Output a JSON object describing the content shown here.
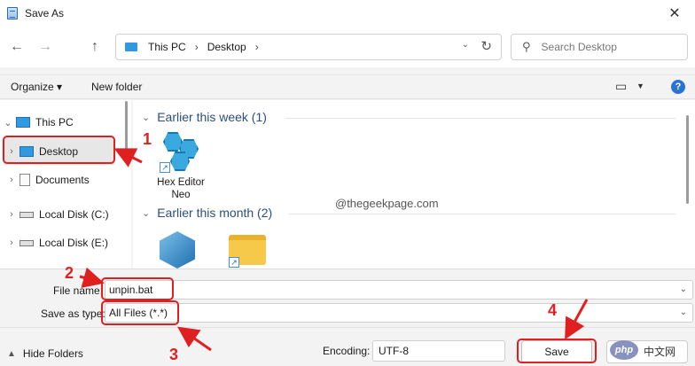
{
  "window": {
    "title": "Save As",
    "close_glyph": "✕"
  },
  "nav": {
    "back_glyph": "←",
    "forward_glyph": "→",
    "up_glyph": "↑"
  },
  "address": {
    "crumbs": [
      "This PC",
      "Desktop"
    ],
    "separator": "›",
    "dropdown_glyph": "⌄",
    "refresh_glyph": "↻"
  },
  "search": {
    "placeholder": "Search Desktop",
    "icon": "search-icon"
  },
  "commandbar": {
    "organize": "Organize ▾",
    "new_folder": "New folder",
    "help": "?"
  },
  "sidebar": {
    "items": [
      {
        "label": "This PC",
        "icon": "computer-icon",
        "chevron": "⌄"
      },
      {
        "label": "Desktop",
        "icon": "desktop-icon",
        "chevron": "›",
        "selected": true
      },
      {
        "label": "Documents",
        "icon": "documents-icon",
        "chevron": "›"
      },
      {
        "label": "Local Disk (C:)",
        "icon": "disk-icon",
        "chevron": "›"
      },
      {
        "label": "Local Disk (E:)",
        "icon": "disk-icon",
        "chevron": "›"
      }
    ]
  },
  "content": {
    "groups": [
      {
        "header": "Earlier this week (1)",
        "chevron": "⌄"
      },
      {
        "header": "Earlier this month (2)",
        "chevron": "⌄"
      }
    ],
    "files": [
      {
        "name_line1": "Hex Editor",
        "name_line2": "Neo",
        "icon": "hex-editor-icon"
      }
    ],
    "watermark": "@thegeekpage.com"
  },
  "fields": {
    "file_name_label": "File name:",
    "file_name_value": "unpin.bat",
    "save_type_label": "Save as type:",
    "save_type_value": "All Files  (*.*)"
  },
  "footer": {
    "hide_folders": "Hide Folders",
    "encoding_label": "Encoding:",
    "encoding_value": "UTF-8",
    "save": "Save",
    "php_logo": "php",
    "php_text": "中文网"
  },
  "annotations": [
    "1",
    "2",
    "3",
    "4"
  ],
  "colors": {
    "annotation": "#e02020",
    "accent": "#2b72d6",
    "folder": "#f6c94a"
  }
}
